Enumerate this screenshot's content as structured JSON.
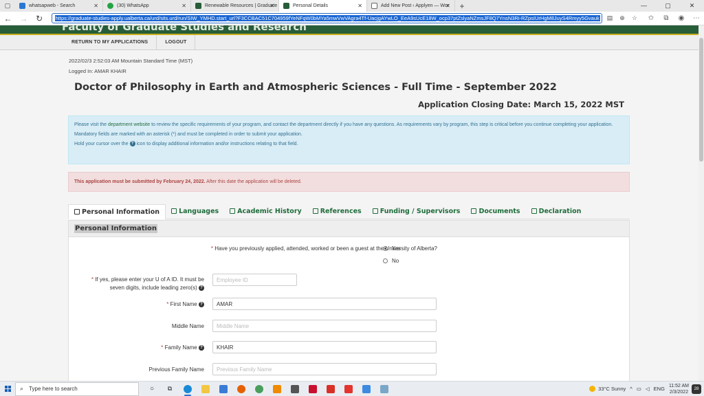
{
  "browser": {
    "tabs": [
      {
        "title": "whatsapweb - Search",
        "color": "#2b78d4"
      },
      {
        "title": "(30) WhatsApp",
        "color": "#25a244"
      },
      {
        "title": "Renewable Resources | Graduate",
        "color": "#275d38"
      },
      {
        "title": "Personal Details",
        "color": "#275d38",
        "active": true
      },
      {
        "title": "Add New Post ‹ Applyen — Wor",
        "color": "#666666"
      }
    ],
    "url": "https://graduate-studies-apply.ualberta.ca/urd/sits.urd/run/SIW_YMHD.start_url?F3CCBAC51C704959fYeNFqW0bMYa5mwVwVAgra4Tf-UacjgAYwLO_EeA9sUcE18W_ocp37ptZslyaNZmsJF8Q7YnsN3Ri-RZpsIUrHgM8JuyS4Rmyy5Gvauk"
  },
  "site": {
    "banner_title": "Faculty of Graduate Studies and Research",
    "menu": [
      "RETURN TO MY APPLICATIONS",
      "LOGOUT"
    ]
  },
  "meta": {
    "timestamp": "2022/02/3 2:52:03 AM Mountain Standard Time (MST)",
    "logged_in": "Logged In: AMAR KHAIR"
  },
  "program": {
    "title": "Doctor of Philosophy in Earth and Atmospheric Sciences - Full Time - September 2022",
    "closing": "Application Closing Date: March 15, 2022 MST"
  },
  "info": {
    "line1_pre": "Please visit the ",
    "line1_link": "department website",
    "line1_post": " to review the specific requirements of your program, and contact the department directly if you have any questions. As requirements vary by program, this step is critical before you continue completing your application.",
    "line2": "Mandatory fields are marked with an asterisk (*) and must be completed in order to submit your application.",
    "line3_pre": "Hold your cursor over the ",
    "line3_post": " icon to display additional information and/or instructions relating to that field."
  },
  "warning": {
    "bold": "This application must be submitted by February 24, 2022.",
    "rest": " After this date the application will be deleted."
  },
  "form_tabs": [
    "Personal Information",
    "Languages",
    "Academic History",
    "References",
    "Funding / Supervisors",
    "Documents",
    "Declaration"
  ],
  "panel_title": "Personal Information",
  "questions": {
    "previous": "Have you previously applied, attended, worked or been a guest at the University of Alberta?",
    "yes": "Yes",
    "no": "No",
    "ua_id_line1": "If yes, please enter your U of A ID. It must be",
    "ua_id_line2": "seven digits, include leading zero(s)",
    "ua_id_placeholder": "Employee ID",
    "first_name_label": "First Name",
    "first_name_value": "AMAR",
    "middle_name_label": "Middle Name",
    "middle_name_placeholder": "Middle Name",
    "family_name_label": "Family Name",
    "family_name_value": "KHAIR",
    "prev_family_label": "Previous Family Name",
    "prev_family_placeholder": "Previous Family Name"
  },
  "taskbar": {
    "search_placeholder": "Type here to search",
    "weather": "33°C  Sunny",
    "lang": "ENG",
    "time": "11:52 AM",
    "date": "2/3/2022",
    "notifications": "28"
  }
}
